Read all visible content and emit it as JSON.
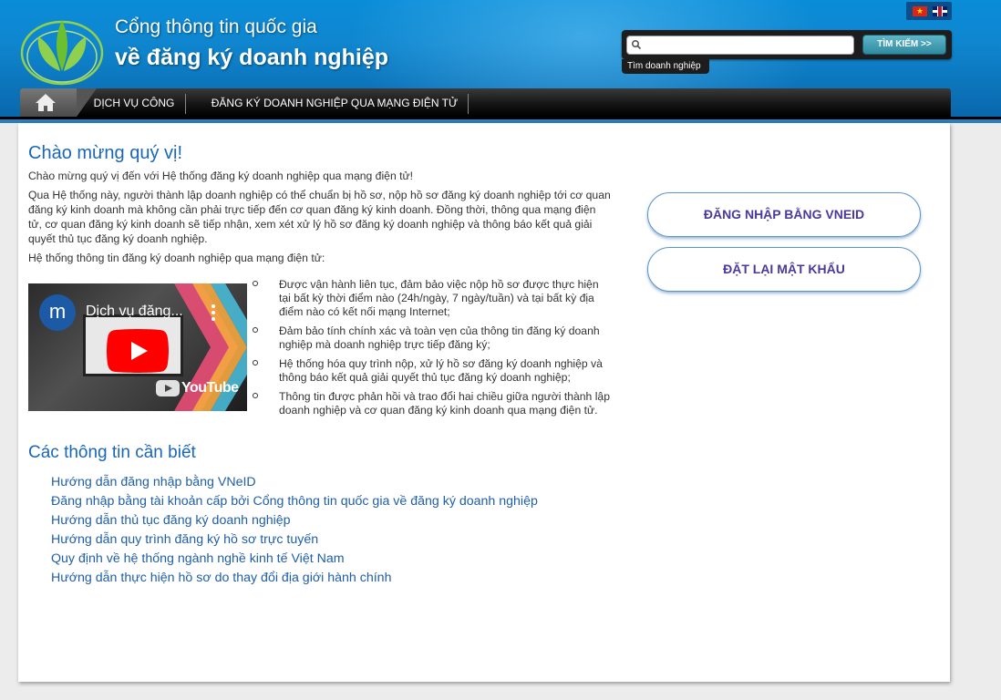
{
  "header": {
    "title_line1": "Cổng thông tin quốc gia",
    "title_line2": "về đăng ký doanh nghiệp",
    "search": {
      "placeholder": "",
      "button_label": "TÌM KIẾM >>",
      "hint": "Tìm doanh nghiệp"
    },
    "languages": [
      "vietnamese-flag-icon",
      "english-flag-icon"
    ]
  },
  "nav": {
    "home_icon": "home-icon",
    "items": [
      {
        "label": "DỊCH VỤ CÔNG"
      },
      {
        "label": "ĐĂNG KÝ DOANH NGHIỆP QUA MẠNG ĐIỆN TỬ"
      }
    ]
  },
  "main": {
    "welcome_title": "Chào mừng quý vị!",
    "intro": "Chào mừng quý vị đến với Hệ thống đăng ký doanh nghiệp qua mạng điện tử!",
    "description": "Qua Hệ thống này, người thành lập doanh nghiệp có thể chuẩn bị hồ sơ, nộp hồ sơ đăng ký doanh nghiệp tới cơ quan đăng ký kinh doanh mà không cần phải trực tiếp đến cơ quan đăng ký kinh doanh. Đồng thời, thông qua mạng điện tử, cơ quan đăng ký kinh doanh sẽ tiếp nhận, xem xét xử lý hồ sơ đăng ký doanh nghiệp và thông báo kết quả giải quyết thủ tục đăng ký doanh nghiệp.",
    "features_intro": "Hệ thống thông tin đăng ký doanh nghiệp qua mạng điện tử:",
    "features": [
      "Được vận hành liên tục, đảm bảo việc nộp hồ sơ được thực hiện tại bất kỳ thời điểm nào (24h/ngày, 7 ngày/tuần) và tại bất kỳ địa điểm nào có kết nối mạng Internet;",
      "Đảm bảo tính chính xác và toàn vẹn của thông tin đăng ký doanh nghiệp mà doanh nghiệp trực tiếp đăng ký;",
      "Hệ thống hóa quy trình nộp, xử lý hồ sơ đăng ký doanh nghiệp và thông báo kết quả giải quyết thủ tục đăng ký doanh nghiệp;",
      "Thông tin được phản hồi và trao đổi hai chiều giữa người thành lập doanh nghiệp và cơ quan đăng ký kinh doanh qua mạng điện tử."
    ],
    "video": {
      "avatar_letter": "m",
      "title": "Dịch vụ đăng...",
      "brand": "YouTube"
    },
    "info_title": "Các thông tin cần biết",
    "links": [
      {
        "label": "Hướng dẫn đăng nhập bằng VNeID"
      },
      {
        "label": "Đăng nhập bằng tài khoản cấp bởi Cổng thông tin quốc gia về đăng ký doanh nghiệp"
      },
      {
        "label": "Hướng dẫn thủ tục đăng ký doanh nghiệp"
      },
      {
        "label": "Hướng dẫn quy trình đăng ký hồ sơ trực tuyến"
      },
      {
        "label": "Quy định về hệ thống ngành nghề kinh tế Việt Nam"
      },
      {
        "label": "Hướng dẫn thực hiện hồ sơ do thay đổi địa giới hành chính"
      }
    ]
  },
  "sidebar": {
    "login_vneid": "ĐĂNG NHẬP BẰNG VNEID",
    "reset_password": "ĐẶT LẠI MẬT KHẨU"
  },
  "colors": {
    "header_blue": "#0a86cf",
    "title_blue": "#1a66b8",
    "link_blue": "#1f5ea8",
    "button_text": "#4a3a9b"
  }
}
